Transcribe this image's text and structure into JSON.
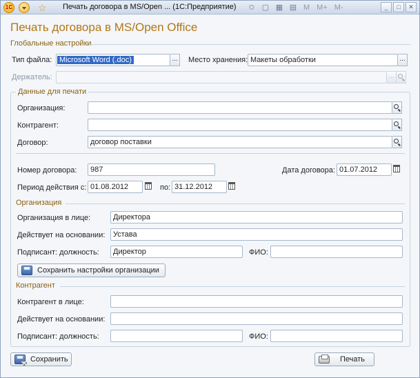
{
  "titlebar": {
    "title": "Печать договора в MS/Open ... (1С:Предприятие)",
    "tools_text": [
      "M",
      "M+",
      "M-"
    ]
  },
  "form": {
    "title": "Печать договора в MS/Open Office"
  },
  "global": {
    "group_label": "Глобальные настройки",
    "file_type_label": "Тип файла:",
    "file_type_value": "Microsoft Word (.doc)",
    "storage_label": "Место хранения:",
    "storage_value": "Макеты обработки",
    "holder_label": "Держатель:",
    "holder_value": ""
  },
  "print_data": {
    "group_label": "Данные для печати",
    "org_label": "Организация:",
    "org_value": "",
    "counterparty_label": "Контрагент:",
    "counterparty_value": "",
    "contract_label": "Договор:",
    "contract_value": "договор поставки",
    "contract_number_label": "Номер договора:",
    "contract_number_value": "987",
    "contract_date_label": "Дата договора:",
    "contract_date_value": "01.07.2012",
    "period_label": "Период действия с:",
    "period_from_value": "01.08.2012",
    "period_to_label": "по:",
    "period_to_value": "31.12.2012"
  },
  "organization": {
    "group_label": "Организация",
    "in_person_label": "Организация в лице:",
    "in_person_value": "Директора",
    "basis_label": "Действует на основании:",
    "basis_value": "Устава",
    "signer_position_label": "Подписант: должность:",
    "signer_position_value": "Директор",
    "signer_name_label": "ФИО:",
    "signer_name_value": "",
    "save_settings_label": "Сохранить настройки организации"
  },
  "counterparty": {
    "group_label": "Контрагент",
    "in_person_label": "Контрагент в лице:",
    "in_person_value": "",
    "basis_label": "Действует на основании:",
    "basis_value": "",
    "signer_position_label": "Подписант: должность:",
    "signer_position_value": "",
    "signer_name_label": "ФИО:",
    "signer_name_value": ""
  },
  "footer": {
    "save_label": "Сохранить",
    "print_label": "Печать"
  },
  "colors": {
    "title_accent": "#b07818",
    "group_label": "#8a6010",
    "selection": "#3169c6"
  },
  "icons": [
    "app-logo-icon",
    "menu-dropdown-icon",
    "favorite-star-icon",
    "search-icon",
    "calendar-icon",
    "save-icon",
    "print-icon"
  ]
}
